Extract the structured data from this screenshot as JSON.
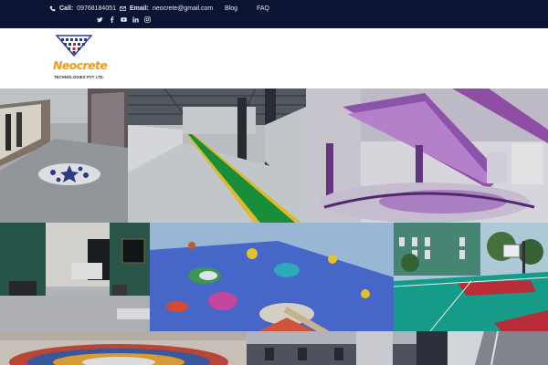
{
  "topbar": {
    "call_label": "Call:",
    "call_value": "09768184051",
    "email_label": "Email:",
    "email_value": "neocrete@gmail.com",
    "nav": {
      "blog": "Blog",
      "faq": "FAQ"
    },
    "socials": [
      "twitter-icon",
      "facebook-icon",
      "youtube-icon",
      "linkedin-icon",
      "instagram-icon"
    ],
    "background_color": "#0c1433"
  },
  "logo": {
    "name": "Neocrete",
    "subtitle": "TECHNOLOGIES PVT LTD.",
    "colors": {
      "wordmark": "#f09a1e",
      "mark_blue": "#2b3a8c",
      "mark_red": "#d2232a"
    }
  },
  "gallery": {
    "items": [
      "warehouse-floor-with-blue-star-inlay",
      "factory-floor-with-green-walkway",
      "mall-atrium-with-purple-escalators",
      "interior-lobby-with-sofa",
      "3d-ocean-epoxy-floor",
      "outdoor-basketball-court",
      "circular-inlay-floor",
      "shopping-mall-corridor",
      "polished-floor-corridor"
    ]
  }
}
